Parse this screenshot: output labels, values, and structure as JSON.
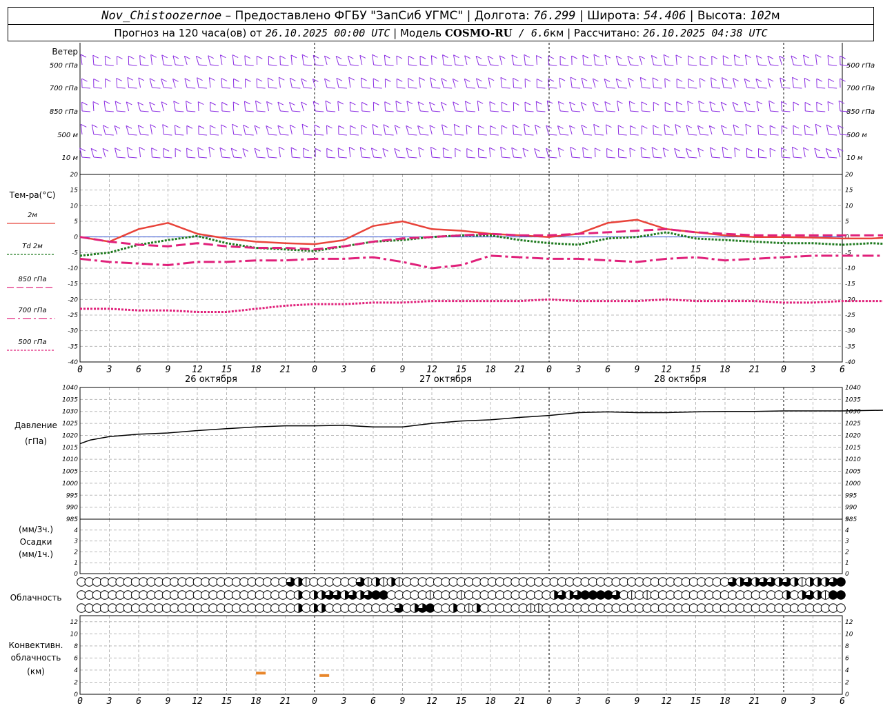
{
  "header": {
    "station": "Nov_Chistoozernoe",
    "provider": " – Предоставлено ФГБУ \"ЗапСиб УГМС\" | Долгота: ",
    "lon": "76.299",
    "lat_label": " | Широта: ",
    "lat": "54.406",
    "alt_label": " | Высота: ",
    "alt": "102",
    "alt_unit": "м",
    "fc_label": "Прогноз на 120 часа(ов) от ",
    "fc_time": "26.10.2025 00:00 UTC",
    "model_label": " | Модель ",
    "model": "COSMO-RU",
    "res": " / 6.6",
    "res_unit": "км",
    "calc_label": " | Рассчитано: ",
    "calc_time": "26.10.2025 04:38 UTC"
  },
  "chart_data": [
    {
      "type": "wind-barbs",
      "title": "Ветер",
      "levels": [
        "500 гПа",
        "700 гПа",
        "850 гПа",
        "500 м",
        "10  м"
      ],
      "series_color": "#8a2be2"
    },
    {
      "type": "line",
      "ylabel": "Тем-ра(°C)",
      "ylim": [
        -40,
        20
      ],
      "ticks": [
        -40,
        -35,
        -30,
        -25,
        -20,
        -15,
        -10,
        -5,
        0,
        5,
        10,
        15,
        20
      ],
      "x": [
        0,
        3,
        6,
        9,
        12,
        15,
        18,
        21,
        24,
        27,
        30,
        33,
        36,
        39,
        42,
        45,
        48,
        51,
        54,
        57,
        60,
        63,
        66,
        69,
        72,
        75,
        78,
        81,
        84,
        87,
        90
      ],
      "series": [
        {
          "name": "2м",
          "color": "#e8433a",
          "dash": "solid",
          "values": [
            0,
            -1.5,
            2.5,
            4.5,
            1,
            -0.5,
            -1.5,
            -2,
            -2.3,
            -1,
            3.5,
            5,
            2.5,
            2,
            1,
            0.5,
            0,
            1,
            4.5,
            5.5,
            2.5,
            1.5,
            0.5,
            0,
            0,
            -0.2,
            -0.5,
            -0.5,
            0,
            1,
            3.7
          ]
        },
        {
          "name": "Td  2м",
          "color": "#1f7a1f",
          "dash": "dot",
          "values": [
            -6,
            -5,
            -2.5,
            -1,
            0.3,
            -2,
            -3.5,
            -4,
            -4.5,
            -3,
            -1.5,
            -1,
            0,
            0.5,
            0.5,
            -1,
            -2,
            -2.5,
            -0.5,
            0,
            1.5,
            -0.5,
            -1,
            -1.5,
            -2,
            -2,
            -2.5,
            -2,
            -2.5,
            -1.5,
            -1
          ]
        },
        {
          "name": "850 гПа",
          "color": "#e0207a",
          "dash": "dash",
          "values": [
            0,
            -1.5,
            -2.5,
            -3,
            -2,
            -3,
            -3.5,
            -3.5,
            -4,
            -3,
            -1.5,
            -0.5,
            0,
            0.5,
            1,
            0.5,
            0.5,
            1,
            1.5,
            2,
            2.5,
            1.5,
            1,
            0.5,
            0.5,
            0.5,
            0.5,
            0.5,
            0.5,
            0.5,
            0.5
          ]
        },
        {
          "name": "700 гПа",
          "color": "#e0207a",
          "dash": "dashdot",
          "values": [
            -7,
            -8,
            -8.5,
            -9,
            -8,
            -8,
            -7.5,
            -7.5,
            -7,
            -7,
            -6.5,
            -8,
            -10,
            -9,
            -6,
            -6.5,
            -7,
            -7,
            -7.5,
            -8,
            -7,
            -6.5,
            -7.5,
            -7,
            -6.5,
            -6,
            -6,
            -6,
            -6,
            -6,
            -5.5
          ]
        },
        {
          "name": "500 гПа",
          "color": "#e0207a",
          "dash": "dense",
          "values": [
            -23,
            -23,
            -23.5,
            -23.5,
            -24,
            -24,
            -23,
            -22,
            -21.5,
            -21.5,
            -21,
            -21,
            -20.5,
            -20.5,
            -20.5,
            -20.5,
            -20,
            -20.5,
            -20.5,
            -20.5,
            -20,
            -20.5,
            -20.5,
            -20.5,
            -21,
            -21,
            -20.5,
            -20.5,
            -20.5,
            -20,
            -20
          ]
        }
      ]
    },
    {
      "type": "line",
      "ylabel": "Давление",
      "ylabel_unit": "(гПа)",
      "ylim": [
        985,
        1040
      ],
      "ticks": [
        985,
        990,
        995,
        1000,
        1005,
        1010,
        1015,
        1020,
        1025,
        1030,
        1035,
        1040
      ],
      "x": [
        0,
        1,
        3,
        6,
        9,
        12,
        15,
        18,
        21,
        24,
        27,
        30,
        33,
        36,
        39,
        42,
        45,
        48,
        51,
        54,
        57,
        60,
        63,
        66,
        69,
        72,
        75,
        78,
        81,
        84,
        87,
        90
      ],
      "series": [
        {
          "name": "Давление",
          "color": "#000000",
          "dash": "solid",
          "values": [
            1016.5,
            1018,
            1019.5,
            1020.5,
            1021,
            1022,
            1022.8,
            1023.5,
            1024,
            1024,
            1024.2,
            1023.5,
            1023.5,
            1025,
            1026,
            1026.5,
            1027.5,
            1028.3,
            1029.5,
            1029.8,
            1029.5,
            1029.5,
            1029.8,
            1030,
            1030,
            1030.2,
            1030.2,
            1030.2,
            1030.4,
            1030.6,
            1030.8,
            1030.6
          ]
        }
      ]
    },
    {
      "type": "bar",
      "ylabel_top": "(мм/3ч.)",
      "ylabel": "Осадки",
      "ylabel_bottom": "(мм/1ч.)",
      "ylim": [
        0,
        5
      ],
      "ticks": [
        0,
        1,
        2,
        3,
        4,
        5
      ],
      "values": []
    },
    {
      "type": "symbols",
      "ylabel": "Облачность",
      "columns": 49,
      "rows": [
        [
          0,
          0,
          0,
          0,
          0,
          0,
          0,
          0,
          0,
          0,
          0,
          0,
          0,
          0,
          0,
          0,
          0,
          0,
          0,
          0,
          0,
          0,
          0,
          0,
          0,
          0,
          0,
          3,
          2,
          1,
          0,
          0,
          0,
          0,
          0,
          0,
          3,
          1,
          2,
          1,
          2,
          1,
          0,
          0,
          0,
          0,
          0,
          0,
          0,
          0,
          0,
          0,
          0,
          0,
          0,
          0,
          0,
          0,
          0,
          0,
          0,
          0,
          0,
          0,
          0,
          0,
          0,
          0,
          0,
          0,
          0,
          0,
          0,
          0,
          0,
          0,
          0,
          0,
          0,
          0,
          0,
          0,
          0,
          0,
          3,
          2,
          3,
          2,
          3,
          3,
          2,
          3,
          2,
          1,
          2,
          2,
          2,
          3,
          4
        ],
        [
          0,
          0,
          0,
          0,
          0,
          0,
          0,
          0,
          0,
          0,
          0,
          0,
          0,
          0,
          0,
          0,
          0,
          0,
          0,
          0,
          0,
          0,
          0,
          0,
          0,
          0,
          0,
          0,
          2,
          0,
          2,
          2,
          3,
          3,
          2,
          3,
          2,
          3,
          4,
          4,
          0,
          0,
          0,
          0,
          0,
          1,
          0,
          0,
          0,
          1,
          0,
          0,
          0,
          0,
          0,
          0,
          0,
          0,
          0,
          0,
          0,
          2,
          3,
          2,
          3,
          4,
          4,
          4,
          4,
          3,
          0,
          1,
          0,
          1,
          0,
          0,
          0,
          0,
          0,
          0,
          0,
          0,
          0,
          0,
          0,
          0,
          0,
          0,
          0,
          0,
          0,
          2,
          0,
          2,
          3,
          2,
          1,
          4,
          4
        ],
        [
          0,
          0,
          0,
          0,
          0,
          0,
          0,
          0,
          0,
          0,
          0,
          0,
          0,
          0,
          0,
          0,
          0,
          0,
          0,
          0,
          0,
          0,
          0,
          0,
          0,
          0,
          0,
          0,
          2,
          0,
          2,
          2,
          0,
          0,
          0,
          0,
          0,
          0,
          0,
          0,
          0,
          3,
          0,
          2,
          3,
          4,
          0,
          0,
          2,
          0,
          1,
          2,
          0,
          0,
          0,
          0,
          0,
          0,
          1,
          1,
          0,
          0,
          0,
          0,
          0,
          0,
          0,
          0,
          0,
          0,
          0,
          0,
          0,
          0,
          0,
          0,
          0,
          0,
          0,
          0,
          0,
          0,
          0,
          0,
          0,
          0,
          0,
          0,
          0,
          0,
          0,
          0,
          0,
          0,
          0,
          0,
          0,
          0,
          0
        ]
      ]
    },
    {
      "type": "bar",
      "ylabel": "Конвективн.",
      "ylabel2": "облачность",
      "ylabel_unit": "(км)",
      "ylim": [
        0,
        13
      ],
      "ticks": [
        0,
        2,
        4,
        6,
        8,
        10,
        12
      ],
      "bars": [
        {
          "x": 37,
          "y": 3.5
        },
        {
          "x": 50,
          "y": 3.1
        }
      ],
      "color": "#e8862a"
    }
  ],
  "x_axis": {
    "hour_labels": [
      "0",
      "3",
      "6",
      "9",
      "12",
      "15",
      "18",
      "21",
      "0",
      "3",
      "6",
      "9",
      "12",
      "15",
      "18",
      "21",
      "0",
      "3",
      "6",
      "9",
      "12",
      "15",
      "18",
      "21",
      "0",
      "3",
      "6"
    ],
    "date_labels": [
      "26 октября",
      "27 октября",
      "28 октября"
    ]
  }
}
